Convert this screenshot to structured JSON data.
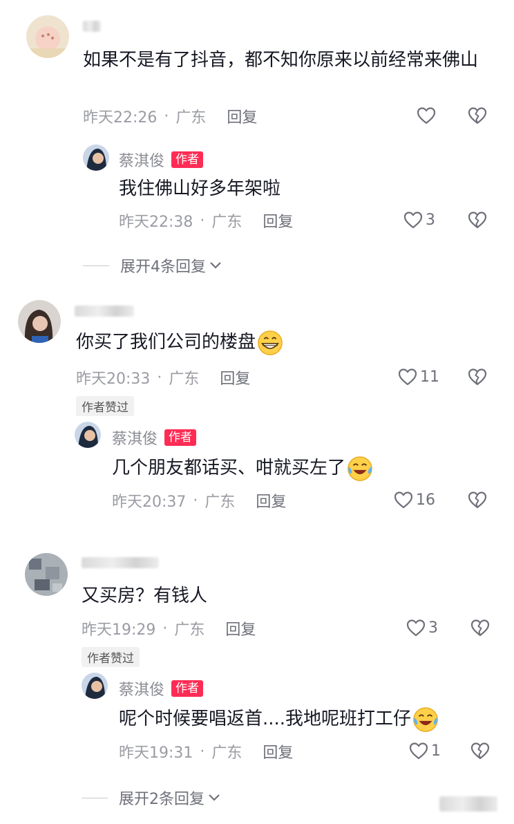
{
  "comments": [
    {
      "text": "如果不是有了抖音，都不知你原来以前经常来佛山",
      "time": "昨天22:26",
      "region": "广东",
      "reply": "回复",
      "likes": "",
      "author_reply": {
        "author": "蔡淇俊",
        "badge": "作者",
        "text": "我住佛山好多年架啦",
        "time": "昨天22:38",
        "region": "广东",
        "reply": "回复",
        "likes": "3"
      },
      "expand": "展开4条回复"
    },
    {
      "text": "你买了我们公司的楼盘",
      "time": "昨天20:33",
      "region": "广东",
      "reply": "回复",
      "likes": "11",
      "author_liked": "作者赞过",
      "author_reply": {
        "author": "蔡淇俊",
        "badge": "作者",
        "text": "几个朋友都话买、咁就买左了",
        "time": "昨天20:37",
        "region": "广东",
        "reply": "回复",
        "likes": "16"
      }
    },
    {
      "text": "又买房？有钱人",
      "time": "昨天19:29",
      "region": "广东",
      "reply": "回复",
      "likes": "3",
      "author_liked": "作者赞过",
      "author_reply": {
        "author": "蔡淇俊",
        "badge": "作者",
        "text": "呢个时候要唱返首....我地呢班打工仔",
        "time": "昨天19:31",
        "region": "广东",
        "reply": "回复",
        "likes": "1"
      },
      "expand": "展开2条回复"
    }
  ],
  "icons": {
    "like": "heart-outline-icon",
    "dislike": "broken-heart-icon",
    "expand": "chevron-down-icon"
  },
  "colors": {
    "badge": "#fe2c55",
    "meta": "#9a9ca3",
    "text": "#161823"
  }
}
